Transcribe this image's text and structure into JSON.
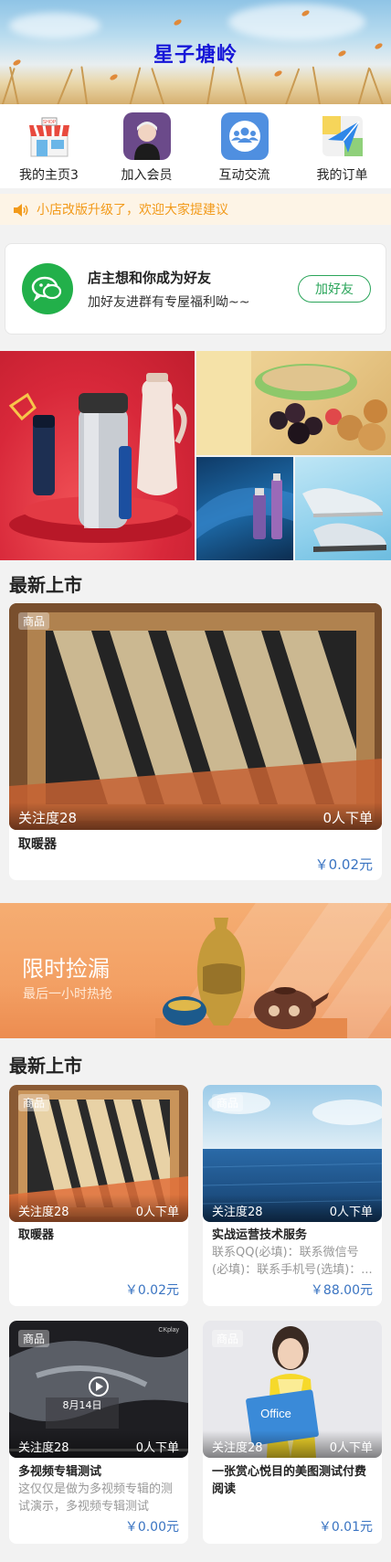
{
  "header": {
    "title": "星子塘岭"
  },
  "nav": [
    {
      "label": "我的主页3",
      "icon": "shop-icon"
    },
    {
      "label": "加入会员",
      "icon": "member-avatar-icon"
    },
    {
      "label": "互动交流",
      "icon": "community-icon"
    },
    {
      "label": "我的订单",
      "icon": "map-order-icon"
    }
  ],
  "notice": {
    "text": "小店改版升级了，欢迎大家提建议",
    "icon": "speaker-icon"
  },
  "friend_card": {
    "title": "店主想和你成为好友",
    "subtitle": "加好友进群有专屋福利呦~~",
    "button": "加好友",
    "icon": "wechat-icon"
  },
  "sections": {
    "new_arrivals_1": "最新上市",
    "new_arrivals_2": "最新上市"
  },
  "featured_product": {
    "tag": "商品",
    "attention": "关注度28",
    "orders": "0人下单",
    "name": "取暖器",
    "price": "￥0.02元"
  },
  "sale_banner": {
    "title": "限时捡漏",
    "subtitle": "最后一小时热抢"
  },
  "products": [
    {
      "tag": "商品",
      "attention": "关注度28",
      "orders": "0人下单",
      "name": "取暖器",
      "desc": "",
      "price": "￥0.02元"
    },
    {
      "tag": "商品",
      "attention": "关注度28",
      "orders": "0人下单",
      "name": "实战运营技术服务",
      "desc": "联系QQ(必填)：联系微信号(必填)：联系手机号(选填)：...",
      "price": "￥88.00元"
    },
    {
      "tag": "商品",
      "attention": "关注度28",
      "orders": "0人下单",
      "name": "多视频专辑测试",
      "desc": "这仅仅是做为多视频专辑的测试演示，多视频专辑测试",
      "price": "￥0.00元",
      "overlay": "8月14日",
      "corner": "CKplay"
    },
    {
      "tag": "商品",
      "attention": "关注度28",
      "orders": "0人下单",
      "name": "一张赏心悦目的美图测试付费阅读",
      "desc": "",
      "price": "￥0.01元",
      "overlay": "Office"
    }
  ],
  "colors": {
    "title_blue": "#1616d8",
    "notice_orange": "#f29a1a",
    "wechat_green": "#22b04a",
    "price_blue": "#3a74c2"
  }
}
